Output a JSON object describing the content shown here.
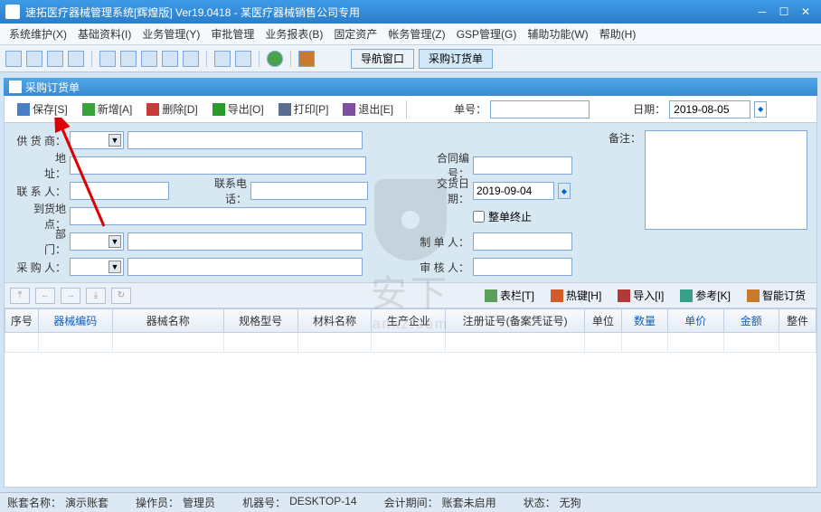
{
  "window": {
    "title": "速拓医疗器械管理系统[辉煌版] Ver19.0418  -  某医疗器械销售公司专用"
  },
  "menu": {
    "items": [
      "系统维护(X)",
      "基础资料(I)",
      "业务管理(Y)",
      "审批管理",
      "业务报表(B)",
      "固定资产",
      "帐务管理(Z)",
      "GSP管理(G)",
      "辅助功能(W)",
      "帮助(H)"
    ]
  },
  "toolbar_buttons": {
    "nav_window": "导航窗口",
    "purchase_order": "采购订货单"
  },
  "subwindow": {
    "title": "采购订货单"
  },
  "actions": {
    "save": "保存[S]",
    "add": "新增[A]",
    "delete": "删除[D]",
    "export": "导出[O]",
    "print": "打印[P]",
    "exit": "退出[E]",
    "order_no_label": "单号：",
    "order_no": "",
    "date_label": "日期：",
    "date": "2019-08-05"
  },
  "form": {
    "left": {
      "supplier_label": "供 货 商：",
      "address_label": "地　　址：",
      "contact_label": "联 系 人：",
      "phone_label": "联系电话：",
      "arrival_label": "到货地点：",
      "dept_label": "部　　门：",
      "buyer_label": "采 购 人："
    },
    "right": {
      "contract_label": "合同编号：",
      "delivery_label": "交货日期：",
      "delivery_date": "2019-09-04",
      "terminate_label": "整单终止",
      "maker_label": "制 单 人：",
      "checker_label": "审 核 人："
    },
    "notes_label": "备注："
  },
  "rec_toolbar": {
    "table_col": "表栏[T]",
    "hotkey": "热键[H]",
    "import": "导入[I]",
    "reference": "参考[K]",
    "smart_order": "智能订货"
  },
  "grid": {
    "cols": [
      "序号",
      "器械编码",
      "器械名称",
      "规格型号",
      "材料名称",
      "生产企业",
      "注册证号(备案凭证号)",
      "单位",
      "数量",
      "单价",
      "金额",
      "整件"
    ],
    "link_cols": [
      1,
      8,
      9,
      10
    ]
  },
  "status": {
    "account_label": "账套名称：",
    "account": "演示账套",
    "operator_label": "操作员：",
    "operator": "管理员",
    "machine_label": "机器号：",
    "machine": "DESKTOP-14",
    "period_label": "会计期间：",
    "period": "账套未启用",
    "state_label": "状态：",
    "state": "无狗"
  },
  "watermark": {
    "text": "安下",
    "url": "anxz.com"
  }
}
